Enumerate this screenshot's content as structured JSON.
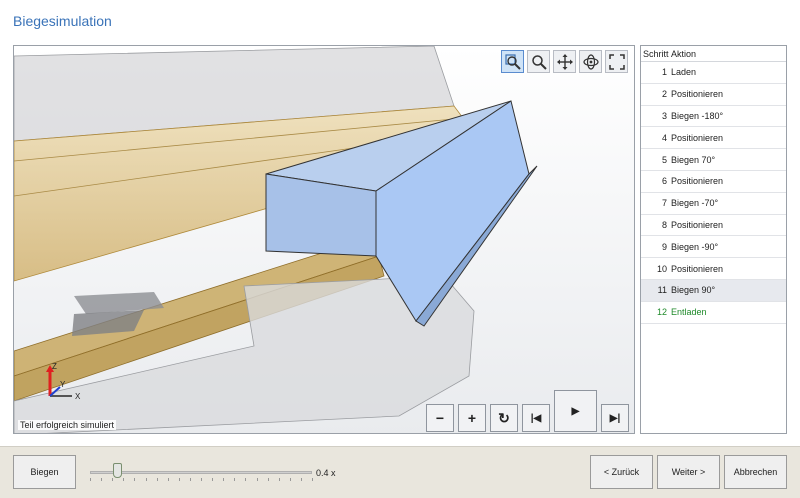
{
  "window": {
    "title": "Biegesimulation"
  },
  "viewport": {
    "status": "Teil erfolgreich simuliert",
    "tools": [
      {
        "name": "zoom-box-icon",
        "active": true
      },
      {
        "name": "zoom-icon",
        "active": false
      },
      {
        "name": "pan-icon",
        "active": false
      },
      {
        "name": "rotate-icon",
        "active": false
      },
      {
        "name": "fit-icon",
        "active": false
      }
    ],
    "axes": {
      "z": "Z",
      "y": "Y",
      "x": "X"
    },
    "playback": {
      "zoom_out": "−",
      "zoom_in": "+",
      "reset": "↻",
      "first": "|◀",
      "play": "▶",
      "last": "▶|"
    }
  },
  "steps": {
    "header": {
      "num": "Schritt",
      "action": "Aktion"
    },
    "rows": [
      {
        "num": "1",
        "action": "Laden"
      },
      {
        "num": "2",
        "action": "Positionieren"
      },
      {
        "num": "3",
        "action": "Biegen -180°"
      },
      {
        "num": "4",
        "action": "Positionieren"
      },
      {
        "num": "5",
        "action": "Biegen 70°"
      },
      {
        "num": "6",
        "action": "Positionieren"
      },
      {
        "num": "7",
        "action": "Biegen -70°"
      },
      {
        "num": "8",
        "action": "Positionieren"
      },
      {
        "num": "9",
        "action": "Biegen -90°"
      },
      {
        "num": "10",
        "action": "Positionieren"
      },
      {
        "num": "11",
        "action": "Biegen 90°"
      },
      {
        "num": "12",
        "action": "Entladen"
      }
    ],
    "selected_index": 10,
    "highlight_index": 11
  },
  "footer": {
    "bend_button": "Biegen",
    "speed_value": "0.4 x",
    "speed_fraction": 0.12,
    "back_button": "< Zurück",
    "next_button": "Weiter >",
    "cancel_button": "Abbrechen"
  },
  "colors": {
    "accent": "#3a73b8",
    "sheet_metal": "#aecbf2",
    "tool_gold": "#d8b460",
    "success_green": "#1f8a2a"
  }
}
